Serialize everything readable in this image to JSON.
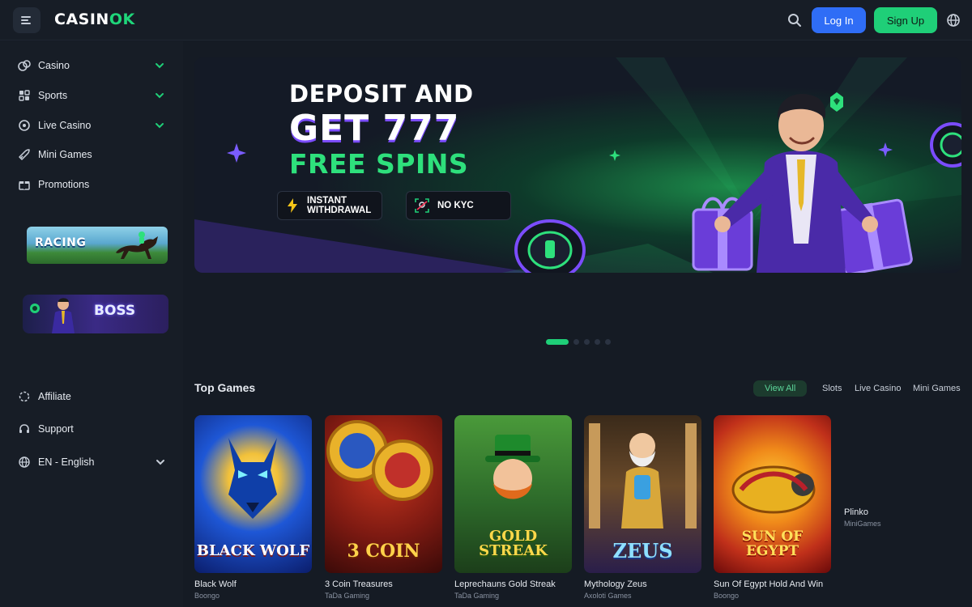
{
  "header": {
    "logo_main": "CASIN",
    "logo_accent": "OK",
    "login_label": "Log In",
    "signup_label": "Sign Up"
  },
  "sidebar": {
    "items": [
      {
        "label": "Casino",
        "icon": "casino-chips-icon",
        "expandable": true
      },
      {
        "label": "Sports",
        "icon": "sports-icon",
        "expandable": true
      },
      {
        "label": "Live Casino",
        "icon": "live-casino-icon",
        "expandable": true
      },
      {
        "label": "Mini Games",
        "icon": "rocket-icon",
        "expandable": false
      },
      {
        "label": "Promotions",
        "icon": "gift-icon",
        "expandable": false
      }
    ],
    "promos": [
      {
        "label": "RACING"
      },
      {
        "label": "BOSS"
      }
    ],
    "bottom": {
      "affiliate": "Affiliate",
      "support": "Support",
      "language": "EN - English"
    }
  },
  "banner": {
    "line1": "DEPOSIT AND",
    "line2": "GET 777",
    "line3": "FREE SPINS",
    "chip_instant": "INSTANT WITHDRAWAL",
    "chip_kyc": "NO KYC",
    "slides": 5,
    "active_slide": 1
  },
  "top_games": {
    "title": "Top Games",
    "filters": [
      {
        "label": "View All",
        "active": true
      },
      {
        "label": "Slots",
        "active": false
      },
      {
        "label": "Live Casino",
        "active": false
      },
      {
        "label": "Mini Games",
        "active": false
      }
    ],
    "games": [
      {
        "name": "Black Wolf",
        "provider": "Boongo",
        "art": "BLACK WOLF"
      },
      {
        "name": "3 Coin Treasures",
        "provider": "TaDa Gaming",
        "art": "3 COIN"
      },
      {
        "name": "Leprechauns Gold Streak",
        "provider": "TaDa Gaming",
        "art": "GOLD STREAK"
      },
      {
        "name": "Mythology Zeus",
        "provider": "Axoloti Games",
        "art": "ZEUS"
      },
      {
        "name": "Sun Of Egypt Hold And Win",
        "provider": "Boongo",
        "art": "SUN OF EGYPT"
      }
    ],
    "extra": {
      "name": "Plinko",
      "provider": "MiniGames"
    }
  },
  "colors": {
    "accent_green": "#1fcf78",
    "login_blue": "#2f6df6",
    "background": "#151b24",
    "sidebar": "#171d26"
  }
}
